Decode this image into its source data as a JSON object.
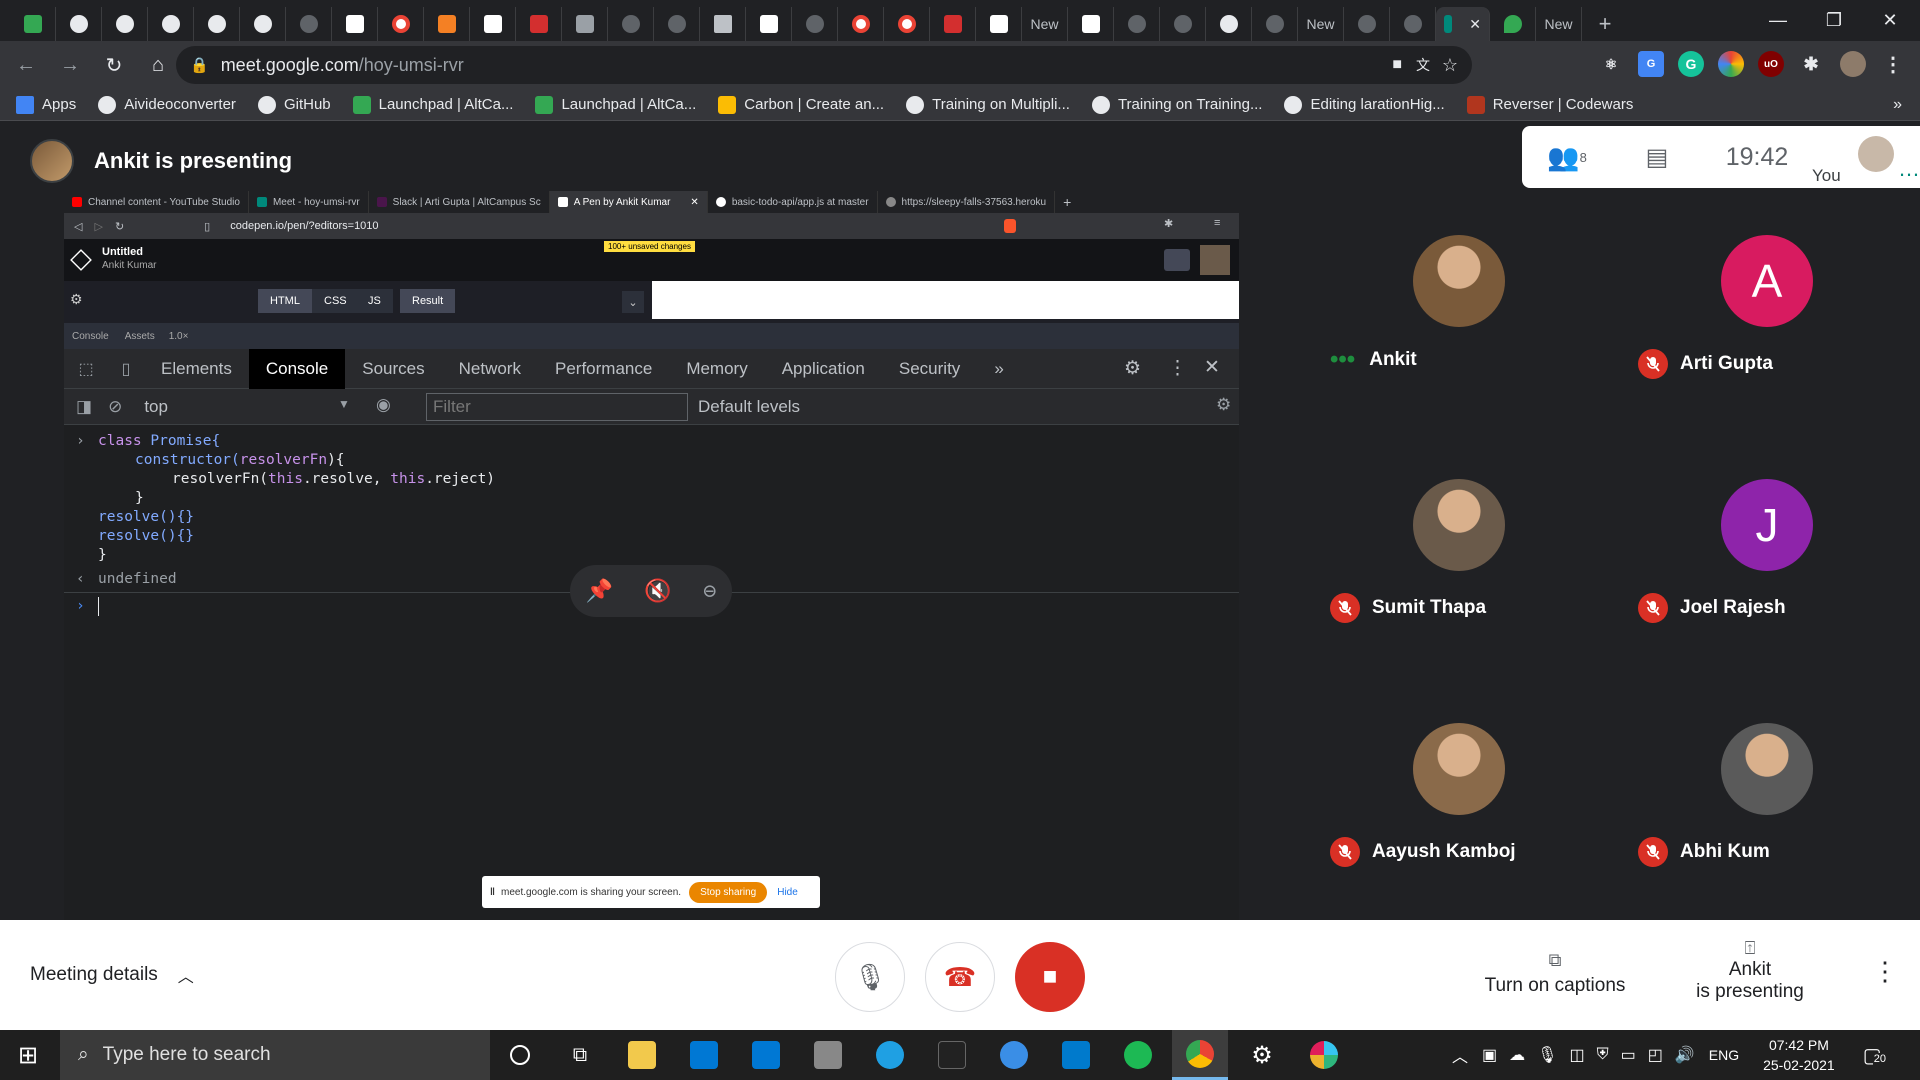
{
  "browser": {
    "tab_new_label": "New",
    "omnibox_host": "meet.google.com",
    "omnibox_path": "/hoy-umsi-rvr",
    "bookmarks": [
      {
        "label": "Apps",
        "color": "#ea4335"
      },
      {
        "label": "Aivideoconverter",
        "color": "#e8eaed"
      },
      {
        "label": "GitHub",
        "color": "#e8eaed"
      },
      {
        "label": "Launchpad | AltCa...",
        "color": "#34a853"
      },
      {
        "label": "Launchpad | AltCa...",
        "color": "#34a853"
      },
      {
        "label": "Carbon | Create an...",
        "color": "#fbbc04"
      },
      {
        "label": "Training on Multipli...",
        "color": "#e8eaed"
      },
      {
        "label": "Training on Training...",
        "color": "#e8eaed"
      },
      {
        "label": "Editing larationHig...",
        "color": "#e8eaed"
      },
      {
        "label": "Reverser | Codewars",
        "color": "#b1361e"
      }
    ],
    "bookmarks_more": "»"
  },
  "meet": {
    "presenter_title": "Ankit is presenting",
    "participant_count": "8",
    "clock": "19:42",
    "you_label": "You",
    "participants": [
      {
        "name": "Ankit",
        "initial": "",
        "color": "#7a5a3a",
        "speaking": true
      },
      {
        "name": "Arti Gupta",
        "initial": "A",
        "color": "#d81b60",
        "speaking": false
      },
      {
        "name": "Sumit Thapa",
        "initial": "",
        "color": "#6a5a4a",
        "speaking": false
      },
      {
        "name": "Joel Rajesh",
        "initial": "J",
        "color": "#8e24aa",
        "speaking": false
      },
      {
        "name": "Aayush Kamboj",
        "initial": "",
        "color": "#8a6a4a",
        "speaking": false
      },
      {
        "name": "Abhi Kum",
        "initial": "",
        "color": "#5a5a5a",
        "speaking": false
      }
    ],
    "meeting_details": "Meeting details",
    "captions": "Turn on captions",
    "presenting_line1": "Ankit",
    "presenting_line2": "is presenting"
  },
  "shared": {
    "tabs": [
      {
        "label": "Channel content - YouTube Studio",
        "color": "#ff0000"
      },
      {
        "label": "Meet - hoy-umsi-rvr",
        "color": "#00897b"
      },
      {
        "label": "Slack | Arti Gupta | AltCampus Sc",
        "color": "#4a154b"
      },
      {
        "label": "A Pen by Ankit Kumar",
        "color": "#ffffff"
      },
      {
        "label": "basic-todo-api/app.js at master",
        "color": "#ffffff"
      },
      {
        "label": "https://sleepy-falls-37563.heroku",
        "color": "#888888"
      }
    ],
    "url": "codepen.io/pen/?editors=1010",
    "unsaved": "100+ unsaved changes",
    "pen_title": "Untitled",
    "pen_author": "Ankit Kumar",
    "editor_tabs": [
      "HTML",
      "CSS",
      "JS",
      "Result"
    ],
    "sub_tabs": [
      "Console",
      "Assets",
      "1.0×"
    ],
    "devtools_tabs": [
      "Elements",
      "Console",
      "Sources",
      "Network",
      "Performance",
      "Memory",
      "Application",
      "Security",
      "»"
    ],
    "context": "top",
    "filter_placeholder": "Filter",
    "levels": "Default levels",
    "console": {
      "l1_kw": "class",
      "l1_name": "Promise{",
      "l2_fn": "constructor(",
      "l2_param": "resolverFn",
      "l2_end": "){",
      "l3_a": "resolverFn(",
      "l3_this1": "this",
      "l3_b": ".resolve, ",
      "l3_this2": "this",
      "l3_c": ".reject)",
      "l4": "}",
      "l5": "resolve(){}",
      "l6": "resolve(){}",
      "l7": "}",
      "result": "undefined"
    },
    "share_text": "meet.google.com is sharing your screen.",
    "stop_sharing": "Stop sharing",
    "hide": "Hide"
  },
  "taskbar": {
    "search_placeholder": "Type here to search",
    "lang": "ENG",
    "time": "07:42 PM",
    "date": "25-02-2021",
    "notif_count": "20"
  }
}
